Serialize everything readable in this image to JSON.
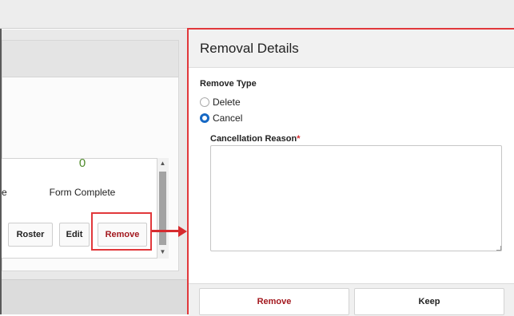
{
  "background": {
    "stat": {
      "value": "0",
      "label": "Form Complete",
      "partial_letter": "e"
    },
    "buttons": {
      "roster": "Roster",
      "edit": "Edit",
      "remove": "Remove"
    }
  },
  "panel": {
    "title": "Removal Details",
    "remove_type_label": "Remove Type",
    "options": [
      {
        "label": "Delete",
        "selected": false
      },
      {
        "label": "Cancel",
        "selected": true
      }
    ],
    "reason_label": "Cancellation Reason",
    "required_mark": "*",
    "reason_value": "",
    "footer": {
      "remove": "Remove",
      "keep": "Keep"
    }
  },
  "colors": {
    "accent_red": "#d62b2f",
    "remove_text": "#a3181e",
    "radio_blue": "#1668c4",
    "stat_green": "#4e8a2a"
  }
}
